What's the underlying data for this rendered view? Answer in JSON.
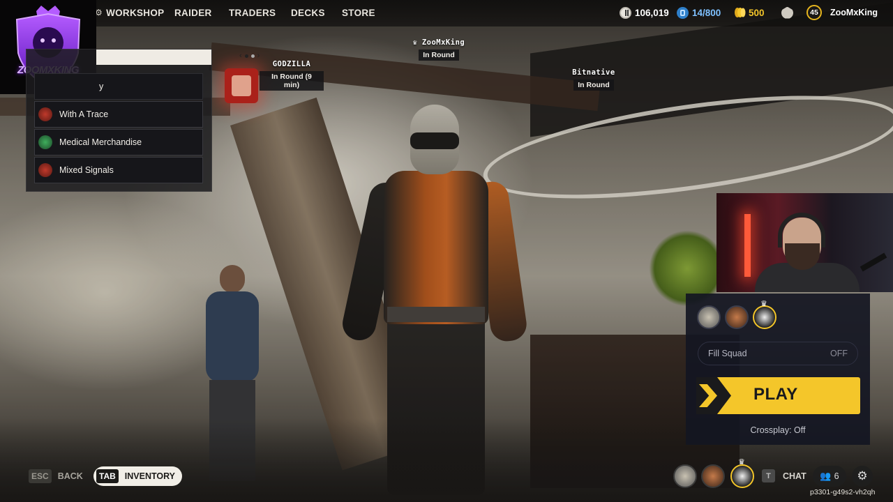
{
  "nav": {
    "items": [
      "WORKSHOP",
      "RAIDER",
      "TRADERS",
      "DECKS",
      "STORE"
    ]
  },
  "resources": {
    "raider_coins": "106,019",
    "tokens": "14/800",
    "gold": "500",
    "level": "45",
    "username": "ZooMxKing"
  },
  "logo": {
    "text": "ZOOMXKING",
    "accent": "#8b2ce8"
  },
  "quest_panel": {
    "partial_item": "y",
    "items": [
      {
        "label": "With A Trace",
        "icon": "quest-trader-icon"
      },
      {
        "label": "Medical Merchandise",
        "icon": "quest-medical-icon"
      },
      {
        "label": "Mixed Signals",
        "icon": "quest-trader-icon"
      }
    ]
  },
  "players": [
    {
      "name": "GODZILLA",
      "status": "In Round (9 min)"
    },
    {
      "name": "ZooMxKing",
      "status": "In Round"
    },
    {
      "name": "Bitnative",
      "status": "In Round"
    }
  ],
  "squad": {
    "fill_label": "Fill Squad",
    "fill_value": "OFF",
    "play_label": "PLAY",
    "crossplay": "Crossplay: Off",
    "accent": "#f4c62a"
  },
  "bottom": {
    "esc_key": "ESC",
    "back_label": "BACK",
    "tab_key": "TAB",
    "inventory_label": "INVENTORY",
    "chat_key": "T",
    "chat_label": "CHAT",
    "friends_count": "6",
    "session_code": "p3301-g49s2-vh2qh"
  }
}
